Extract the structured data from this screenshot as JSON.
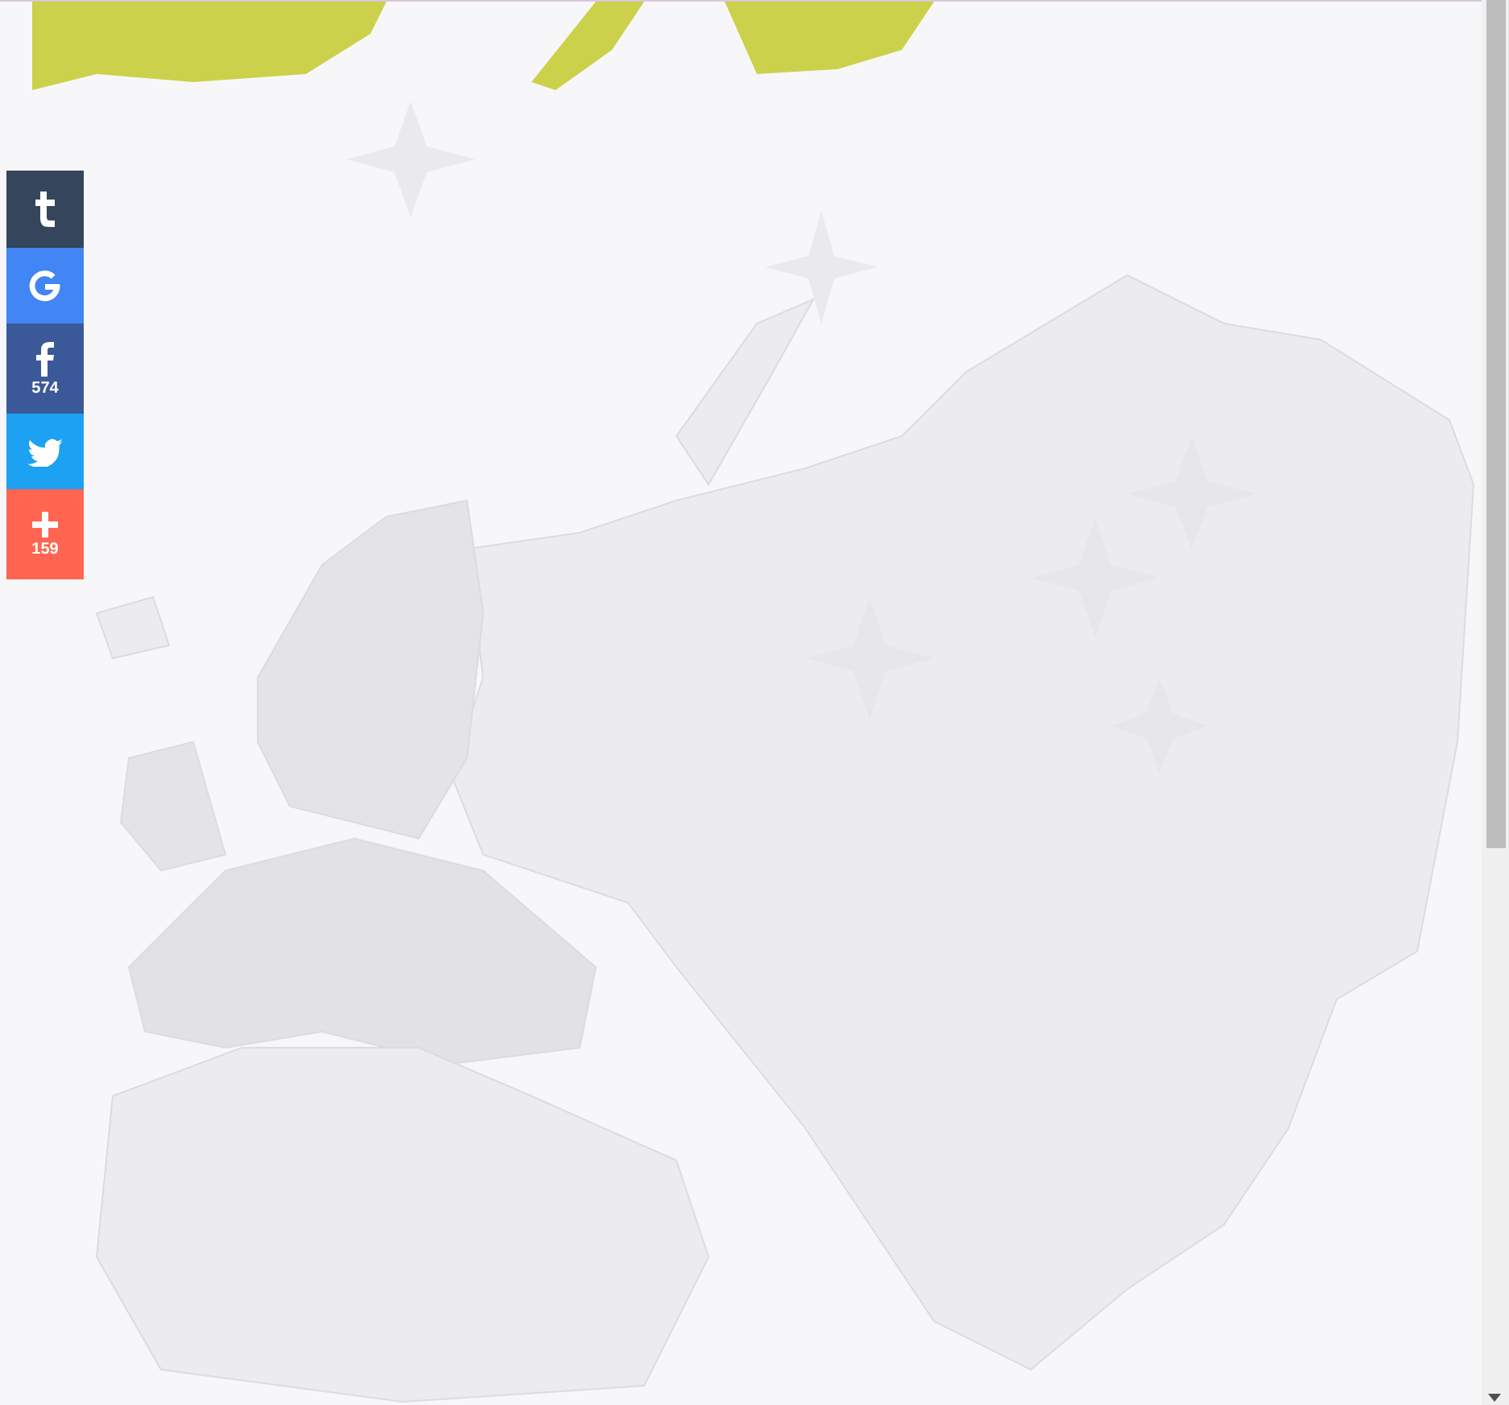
{
  "share_buttons": [
    {
      "kind": "tumblr"
    },
    {
      "kind": "google"
    },
    {
      "kind": "facebook",
      "count": "574"
    },
    {
      "kind": "twitter"
    },
    {
      "kind": "more",
      "count": "159"
    }
  ]
}
